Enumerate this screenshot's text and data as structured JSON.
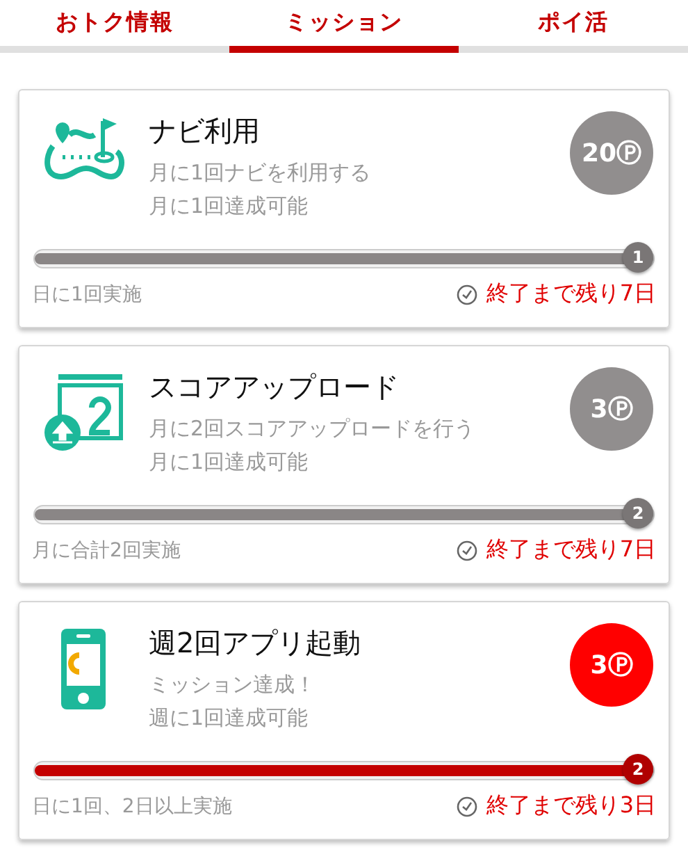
{
  "tabs": [
    {
      "label": "おトク情報",
      "selected": false
    },
    {
      "label": "ミッション",
      "selected": true
    },
    {
      "label": "ポイ活",
      "selected": false
    }
  ],
  "missions": [
    {
      "kind": "navi",
      "title": "ナビ利用",
      "description": "月に1回ナビを利用する",
      "note": "月に1回達成可能",
      "points": "20Ⓟ",
      "achieved": false,
      "level": 1,
      "count": "1",
      "frequency": "日に1回実施",
      "deadline": "終了まで残り7日"
    },
    {
      "kind": "upload",
      "title": "スコアアップロード",
      "description": "月に2回スコアアップロードを行う",
      "note": "月に1回達成可能",
      "points": "3Ⓟ",
      "achieved": false,
      "level": 1,
      "count": "2",
      "frequency": "月に合計2回実施",
      "deadline": "終了まで残り7日"
    },
    {
      "kind": "phone",
      "title": "週2回アプリ起動",
      "description": "ミッション達成！",
      "note": "週に1回達成可能",
      "points": "3Ⓟ",
      "achieved": true,
      "level": 1,
      "count": "2",
      "frequency": "日に1回、2日以上実施",
      "deadline": "終了まで残り3日"
    }
  ]
}
